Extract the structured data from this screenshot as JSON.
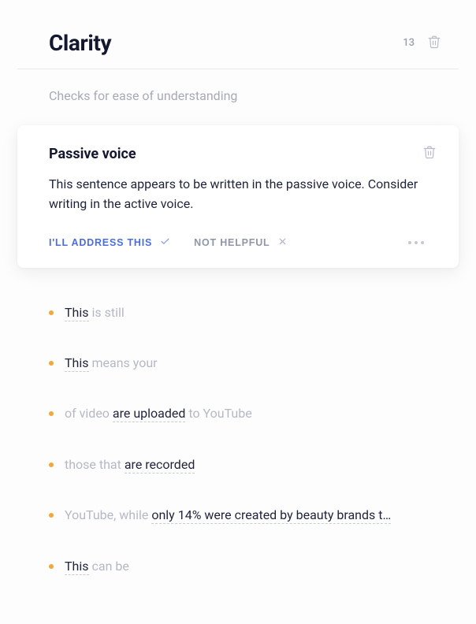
{
  "header": {
    "title": "Clarity",
    "count": "13"
  },
  "subtitle": "Checks for ease of understanding",
  "card": {
    "title": "Passive voice",
    "body": "This sentence appears to be written in the passive voice. Consider writing in the active voice.",
    "address_label": "I'LL ADDRESS THIS",
    "nothelpful_label": "NOT HELPFUL"
  },
  "items": [
    {
      "pre_emph": "This",
      "pre_rest": " is still",
      "mid": "",
      "post": ""
    },
    {
      "pre_emph": "This",
      "pre_rest": " means your",
      "mid": "",
      "post": ""
    },
    {
      "pre_emph": "",
      "pre_rest": "of video ",
      "mid": "are uploaded",
      "post": " to YouTube"
    },
    {
      "pre_emph": "",
      "pre_rest": "those that ",
      "mid": "are recorded",
      "post": ""
    },
    {
      "pre_emph": "",
      "pre_rest": "YouTube, while ",
      "mid": "only 14% were created by beauty brands t…",
      "post": ""
    },
    {
      "pre_emph": "This",
      "pre_rest": " can be",
      "mid": "",
      "post": ""
    }
  ]
}
